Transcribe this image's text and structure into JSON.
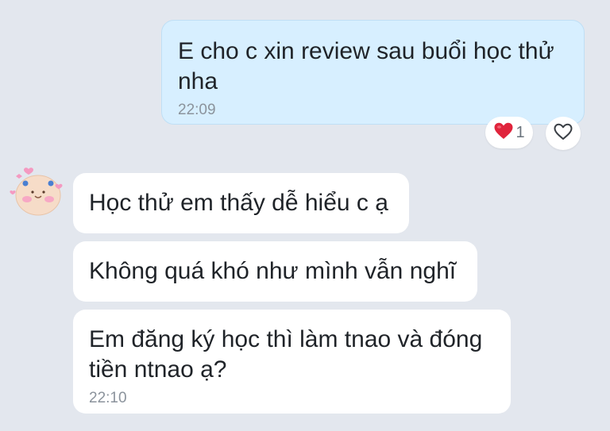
{
  "conversation": {
    "outgoing": {
      "text": "E cho c xin review sau buổi học thử\nnha",
      "time": "22:09",
      "reaction": {
        "icon": "heart-icon",
        "color": "#e0243c",
        "count": "1"
      }
    },
    "incoming": [
      {
        "text": "Học thử em thấy dễ hiểu c ạ"
      },
      {
        "text": "Không quá khó như mình vẫn nghĩ"
      },
      {
        "text": "Em đăng ký học thì làm tnao và đóng\ntiền ntnao ạ?",
        "time": "22:10"
      }
    ]
  },
  "colors": {
    "background": "#e3e7ee",
    "outgoing_bubble": "#d7efff",
    "incoming_bubble": "#ffffff",
    "timestamp": "#8b939c"
  }
}
